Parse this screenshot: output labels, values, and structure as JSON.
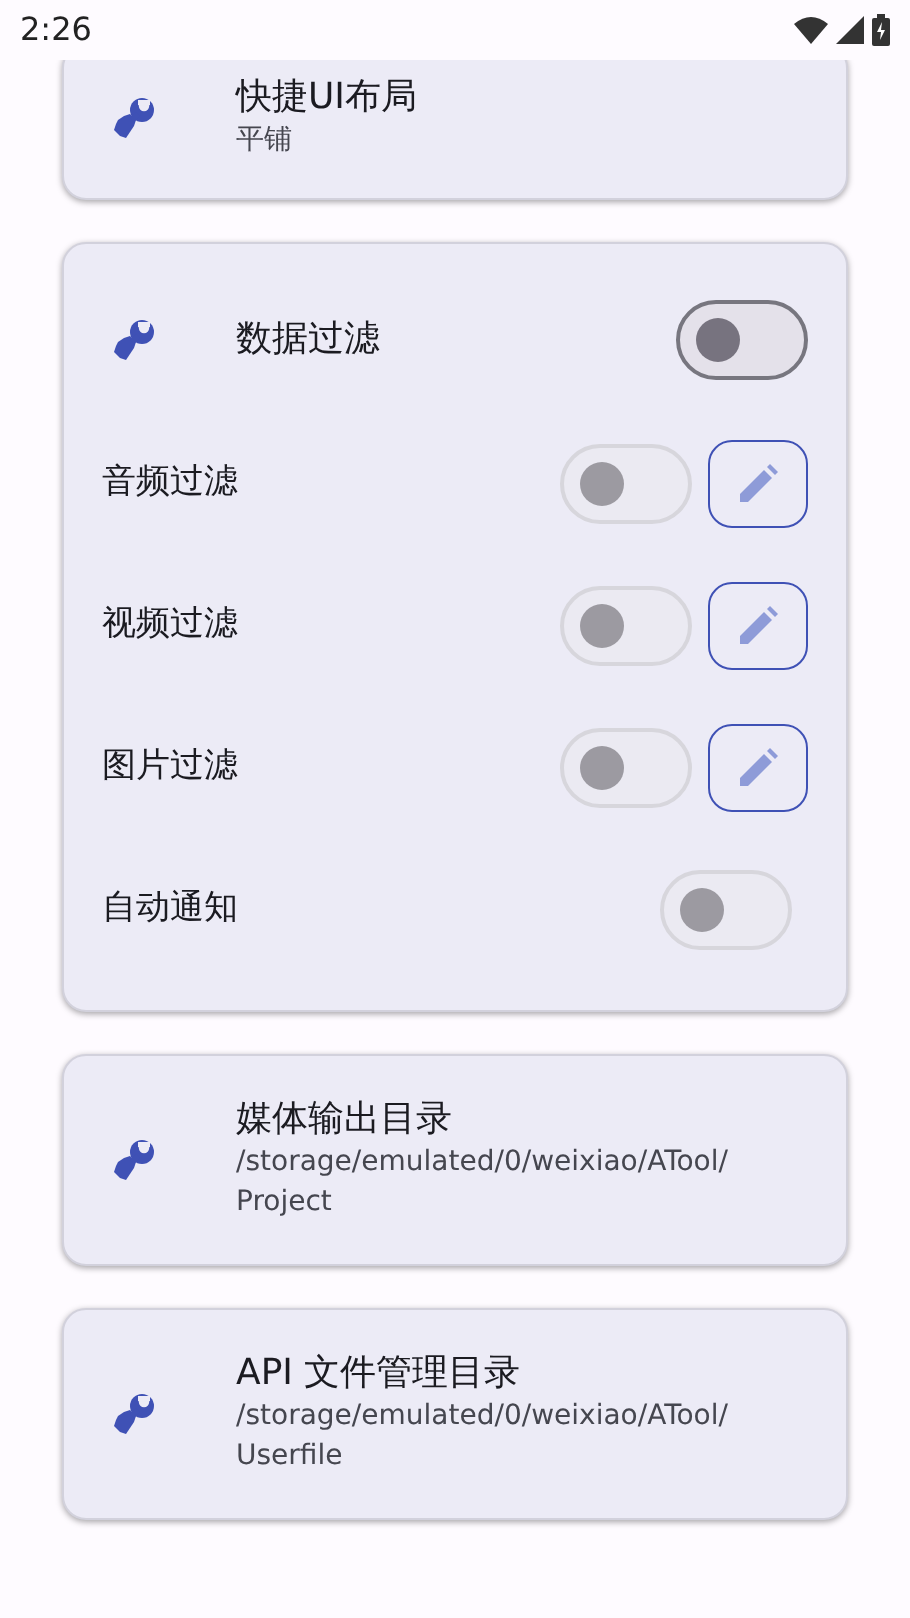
{
  "status_bar": {
    "time": "2:26"
  },
  "cards": [
    {
      "kind": "info",
      "title": "快捷UI布局",
      "subtitle": "平铺"
    },
    {
      "kind": "filter",
      "title": "数据过滤",
      "on": false,
      "rows": [
        {
          "label": "音频过滤",
          "on": false,
          "disabled": true,
          "editable": true
        },
        {
          "label": "视频过滤",
          "on": false,
          "disabled": true,
          "editable": true
        },
        {
          "label": "图片过滤",
          "on": false,
          "disabled": true,
          "editable": true
        },
        {
          "label": "自动通知",
          "on": false,
          "disabled": true,
          "editable": false
        }
      ]
    },
    {
      "kind": "info",
      "title": "媒体输出目录",
      "subtitle": "/storage/emulated/0/weixiao/ATool/Project"
    },
    {
      "kind": "info",
      "title": "API 文件管理目录",
      "subtitle": "/storage/emulated/0/weixiao/ATool/Userfile"
    }
  ]
}
